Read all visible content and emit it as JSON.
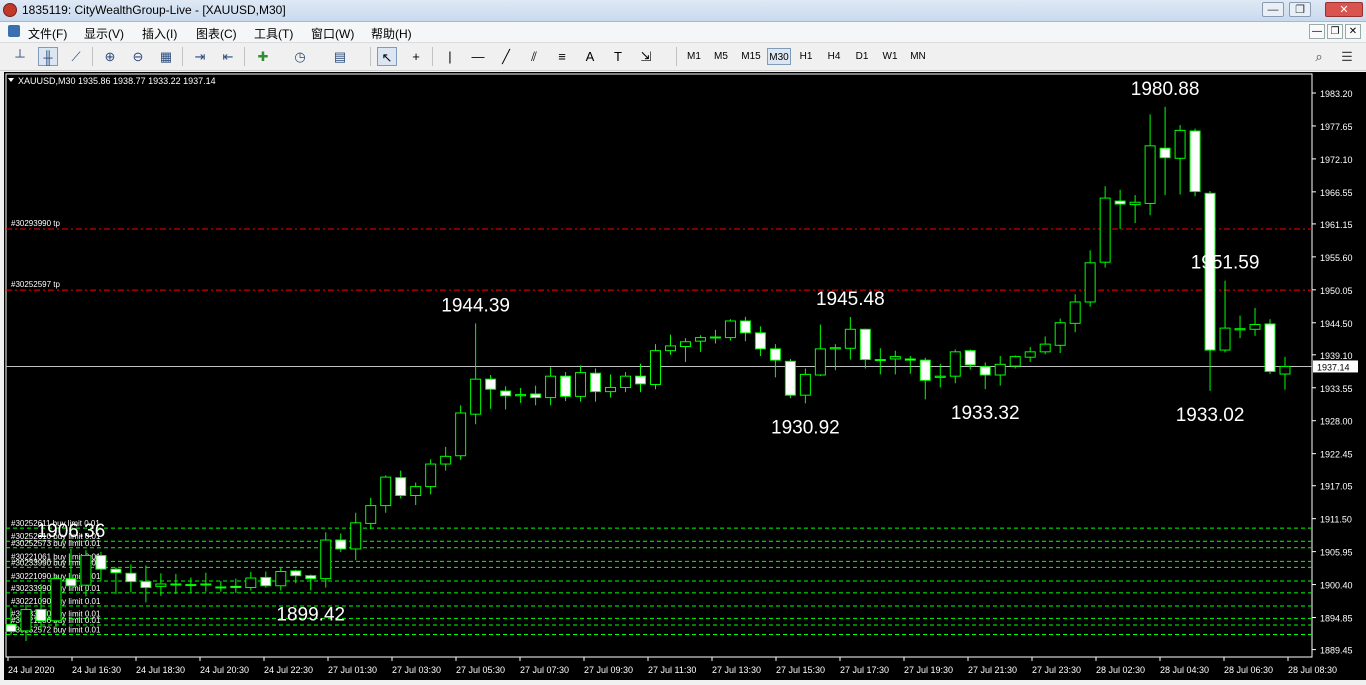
{
  "window": {
    "title": "1835119: CityWealthGroup-Live - [XAUUSD,M30]",
    "controls": {
      "minimize": "—",
      "restore": "❐",
      "close": "✕"
    }
  },
  "menu": {
    "items": [
      "文件(F)",
      "显示(V)",
      "插入(I)",
      "图表(C)",
      "工具(T)",
      "窗口(W)",
      "帮助(H)"
    ]
  },
  "toolbar": {
    "timeframes": [
      "M1",
      "M5",
      "M15",
      "M30",
      "H1",
      "H4",
      "D1",
      "W1",
      "MN"
    ],
    "active_timeframe": "M30",
    "icons": [
      "bar-chart-icon",
      "candlestick-icon",
      "line-chart-icon",
      "zoom-in-icon",
      "zoom-out-icon",
      "tile-windows-icon",
      "autoscroll-icon",
      "chart-shift-icon",
      "indicators-icon",
      "periods-icon",
      "templates-icon",
      "cursor-icon",
      "crosshair-icon",
      "vertical-line-icon",
      "horizontal-line-icon",
      "trendline-icon",
      "equidistant-channel-icon",
      "fibonacci-icon",
      "text-icon",
      "text-label-icon",
      "arrows-icon"
    ]
  },
  "chart_info": {
    "label": "XAUUSD,M30  1935.86 1938.77 1933.22 1937.14"
  },
  "colors": {
    "background": "#000000",
    "bull": "#00ff00",
    "bear_body": "#ffffff",
    "grid": "#ff0000",
    "order": "#00ff00",
    "bid": "#c0c0c0"
  },
  "current_price": "1937.14",
  "chart_data": {
    "type": "candlestick",
    "symbol": "XAUUSD",
    "timeframe": "M30",
    "ylim": [
      1888.2,
      1986.4
    ],
    "price_ticks": [
      "1983.20",
      "1977.65",
      "1972.10",
      "1966.55",
      "1961.15",
      "1955.60",
      "1950.05",
      "1944.50",
      "1939.10",
      "1933.55",
      "1928.00",
      "1922.45",
      "1917.05",
      "1911.50",
      "1905.95",
      "1900.40",
      "1894.85",
      "1889.45"
    ],
    "time_ticks": [
      "24 Jul 2020",
      "24 Jul 16:30",
      "24 Jul 18:30",
      "24 Jul 20:30",
      "24 Jul 22:30",
      "27 Jul 01:30",
      "27 Jul 03:30",
      "27 Jul 05:30",
      "27 Jul 07:30",
      "27 Jul 09:30",
      "27 Jul 11:30",
      "27 Jul 13:30",
      "27 Jul 15:30",
      "27 Jul 17:30",
      "27 Jul 19:30",
      "27 Jul 21:30",
      "27 Jul 23:30",
      "28 Jul 02:30",
      "28 Jul 04:30",
      "28 Jul 06:30",
      "28 Jul 08:30"
    ],
    "candles": [
      {
        "o": 1893.7,
        "h": 1896.5,
        "l": 1891.9,
        "c": 1892.5
      },
      {
        "o": 1892.6,
        "h": 1897.0,
        "l": 1890.9,
        "c": 1896.2
      },
      {
        "o": 1896.2,
        "h": 1900.5,
        "l": 1892.5,
        "c": 1894.3
      },
      {
        "o": 1894.3,
        "h": 1901.8,
        "l": 1893.0,
        "c": 1901.4
      },
      {
        "o": 1901.4,
        "h": 1906.4,
        "l": 1899.8,
        "c": 1900.2
      },
      {
        "o": 1900.3,
        "h": 1906.2,
        "l": 1898.4,
        "c": 1905.3
      },
      {
        "o": 1905.3,
        "h": 1905.9,
        "l": 1901.1,
        "c": 1903.0
      },
      {
        "o": 1903.0,
        "h": 1903.3,
        "l": 1898.8,
        "c": 1902.4
      },
      {
        "o": 1902.3,
        "h": 1903.8,
        "l": 1899.1,
        "c": 1900.9
      },
      {
        "o": 1900.9,
        "h": 1903.6,
        "l": 1897.4,
        "c": 1899.9
      },
      {
        "o": 1900.1,
        "h": 1902.3,
        "l": 1898.5,
        "c": 1900.5
      },
      {
        "o": 1900.4,
        "h": 1902.2,
        "l": 1898.8,
        "c": 1900.5
      },
      {
        "o": 1900.4,
        "h": 1901.6,
        "l": 1899.0,
        "c": 1900.3
      },
      {
        "o": 1900.4,
        "h": 1902.4,
        "l": 1899.2,
        "c": 1900.5
      },
      {
        "o": 1900.0,
        "h": 1901.0,
        "l": 1899.2,
        "c": 1900.0
      },
      {
        "o": 1900.1,
        "h": 1901.4,
        "l": 1899.0,
        "c": 1899.9
      },
      {
        "o": 1899.9,
        "h": 1902.5,
        "l": 1899.4,
        "c": 1901.5
      },
      {
        "o": 1901.6,
        "h": 1902.6,
        "l": 1899.9,
        "c": 1900.2
      },
      {
        "o": 1900.2,
        "h": 1903.2,
        "l": 1899.4,
        "c": 1902.6
      },
      {
        "o": 1902.7,
        "h": 1902.9,
        "l": 1900.6,
        "c": 1901.9
      },
      {
        "o": 1901.9,
        "h": 1902.1,
        "l": 1899.42,
        "c": 1901.4
      },
      {
        "o": 1901.4,
        "h": 1909.2,
        "l": 1899.9,
        "c": 1907.9
      },
      {
        "o": 1907.9,
        "h": 1909.0,
        "l": 1905.9,
        "c": 1906.4
      },
      {
        "o": 1906.4,
        "h": 1912.5,
        "l": 1904.5,
        "c": 1910.8
      },
      {
        "o": 1910.7,
        "h": 1915.0,
        "l": 1909.7,
        "c": 1913.7
      },
      {
        "o": 1913.7,
        "h": 1918.8,
        "l": 1912.5,
        "c": 1918.5
      },
      {
        "o": 1918.4,
        "h": 1919.6,
        "l": 1914.9,
        "c": 1915.4
      },
      {
        "o": 1915.4,
        "h": 1917.6,
        "l": 1913.8,
        "c": 1916.9
      },
      {
        "o": 1916.9,
        "h": 1921.5,
        "l": 1915.6,
        "c": 1920.7
      },
      {
        "o": 1920.7,
        "h": 1923.6,
        "l": 1919.6,
        "c": 1922.0
      },
      {
        "o": 1922.1,
        "h": 1930.6,
        "l": 1921.4,
        "c": 1929.3
      },
      {
        "o": 1929.1,
        "h": 1944.39,
        "l": 1927.4,
        "c": 1935.0
      },
      {
        "o": 1935.0,
        "h": 1935.7,
        "l": 1930.0,
        "c": 1933.3
      },
      {
        "o": 1933.0,
        "h": 1933.8,
        "l": 1929.9,
        "c": 1932.2
      },
      {
        "o": 1932.2,
        "h": 1933.5,
        "l": 1931.0,
        "c": 1932.4
      },
      {
        "o": 1932.5,
        "h": 1933.9,
        "l": 1930.6,
        "c": 1931.9
      },
      {
        "o": 1931.9,
        "h": 1937.0,
        "l": 1930.6,
        "c": 1935.5
      },
      {
        "o": 1935.5,
        "h": 1936.2,
        "l": 1931.3,
        "c": 1932.1
      },
      {
        "o": 1932.1,
        "h": 1937.3,
        "l": 1931.2,
        "c": 1936.1
      },
      {
        "o": 1936.0,
        "h": 1936.8,
        "l": 1931.2,
        "c": 1932.9
      },
      {
        "o": 1932.9,
        "h": 1935.8,
        "l": 1931.9,
        "c": 1933.6
      },
      {
        "o": 1933.6,
        "h": 1936.2,
        "l": 1932.8,
        "c": 1935.5
      },
      {
        "o": 1935.5,
        "h": 1937.6,
        "l": 1932.8,
        "c": 1934.2
      },
      {
        "o": 1934.1,
        "h": 1940.9,
        "l": 1933.3,
        "c": 1939.8
      },
      {
        "o": 1939.8,
        "h": 1942.5,
        "l": 1939.1,
        "c": 1940.6
      },
      {
        "o": 1940.5,
        "h": 1941.9,
        "l": 1937.9,
        "c": 1941.3
      },
      {
        "o": 1941.4,
        "h": 1942.4,
        "l": 1939.6,
        "c": 1942.0
      },
      {
        "o": 1942.0,
        "h": 1943.3,
        "l": 1941.0,
        "c": 1942.1
      },
      {
        "o": 1942.0,
        "h": 1945.1,
        "l": 1941.5,
        "c": 1944.8
      },
      {
        "o": 1944.8,
        "h": 1945.5,
        "l": 1941.4,
        "c": 1942.8
      },
      {
        "o": 1942.8,
        "h": 1943.9,
        "l": 1938.9,
        "c": 1940.1
      },
      {
        "o": 1940.1,
        "h": 1940.9,
        "l": 1935.3,
        "c": 1938.2
      },
      {
        "o": 1938.0,
        "h": 1938.4,
        "l": 1931.8,
        "c": 1932.3
      },
      {
        "o": 1932.3,
        "h": 1936.8,
        "l": 1930.92,
        "c": 1935.8
      },
      {
        "o": 1935.7,
        "h": 1944.2,
        "l": 1935.5,
        "c": 1940.1
      },
      {
        "o": 1940.1,
        "h": 1940.9,
        "l": 1936.5,
        "c": 1940.3
      },
      {
        "o": 1940.2,
        "h": 1945.48,
        "l": 1938.3,
        "c": 1943.4
      },
      {
        "o": 1943.4,
        "h": 1943.5,
        "l": 1936.8,
        "c": 1938.3
      },
      {
        "o": 1938.3,
        "h": 1940.2,
        "l": 1935.8,
        "c": 1938.2
      },
      {
        "o": 1938.4,
        "h": 1939.8,
        "l": 1935.8,
        "c": 1938.8
      },
      {
        "o": 1938.4,
        "h": 1938.9,
        "l": 1935.9,
        "c": 1938.2
      },
      {
        "o": 1938.2,
        "h": 1938.6,
        "l": 1931.6,
        "c": 1934.8
      },
      {
        "o": 1935.3,
        "h": 1937.6,
        "l": 1933.6,
        "c": 1935.5
      },
      {
        "o": 1935.5,
        "h": 1940.0,
        "l": 1934.3,
        "c": 1939.6
      },
      {
        "o": 1939.8,
        "h": 1940.0,
        "l": 1936.6,
        "c": 1937.4
      },
      {
        "o": 1937.1,
        "h": 1937.8,
        "l": 1933.32,
        "c": 1935.7
      },
      {
        "o": 1935.7,
        "h": 1938.9,
        "l": 1933.9,
        "c": 1937.5
      },
      {
        "o": 1937.2,
        "h": 1939.0,
        "l": 1936.8,
        "c": 1938.8
      },
      {
        "o": 1938.7,
        "h": 1940.4,
        "l": 1937.9,
        "c": 1939.6
      },
      {
        "o": 1939.6,
        "h": 1942.2,
        "l": 1939.2,
        "c": 1940.9
      },
      {
        "o": 1940.7,
        "h": 1945.2,
        "l": 1939.4,
        "c": 1944.5
      },
      {
        "o": 1944.4,
        "h": 1949.3,
        "l": 1942.9,
        "c": 1948.0
      },
      {
        "o": 1948.0,
        "h": 1956.7,
        "l": 1947.2,
        "c": 1954.6
      },
      {
        "o": 1954.7,
        "h": 1967.5,
        "l": 1953.8,
        "c": 1965.5
      },
      {
        "o": 1965.0,
        "h": 1966.9,
        "l": 1960.3,
        "c": 1964.5
      },
      {
        "o": 1964.4,
        "h": 1966.0,
        "l": 1961.3,
        "c": 1964.8
      },
      {
        "o": 1964.6,
        "h": 1979.6,
        "l": 1962.6,
        "c": 1974.3
      },
      {
        "o": 1973.9,
        "h": 1980.88,
        "l": 1966.0,
        "c": 1972.3
      },
      {
        "o": 1972.2,
        "h": 1977.8,
        "l": 1966.1,
        "c": 1976.9
      },
      {
        "o": 1976.8,
        "h": 1977.2,
        "l": 1965.8,
        "c": 1966.6
      },
      {
        "o": 1966.3,
        "h": 1966.7,
        "l": 1933.02,
        "c": 1939.9
      },
      {
        "o": 1939.9,
        "h": 1951.59,
        "l": 1939.5,
        "c": 1943.6
      },
      {
        "o": 1943.3,
        "h": 1945.7,
        "l": 1941.9,
        "c": 1943.5
      },
      {
        "o": 1943.4,
        "h": 1947.0,
        "l": 1942.3,
        "c": 1944.2
      },
      {
        "o": 1944.3,
        "h": 1945.1,
        "l": 1935.86,
        "c": 1936.3
      },
      {
        "o": 1935.86,
        "h": 1938.77,
        "l": 1933.22,
        "c": 1937.14
      }
    ],
    "annotations": [
      {
        "text": "1906.36",
        "price": 1906.36
      },
      {
        "text": "1899.42",
        "price": 1899.42
      },
      {
        "text": "1944.39",
        "price": 1944.39
      },
      {
        "text": "1930.92",
        "price": 1930.92
      },
      {
        "text": "1945.48",
        "price": 1945.48
      },
      {
        "text": "1933.32",
        "price": 1933.32
      },
      {
        "text": "1980.88",
        "price": 1980.88
      },
      {
        "text": "1951.59",
        "price": 1951.59
      },
      {
        "text": "1933.02",
        "price": 1933.02
      }
    ],
    "tp_lines": [
      {
        "price": 1960.3,
        "label": "#30293990 tp"
      },
      {
        "price": 1950.0,
        "label": "#30252597 tp"
      }
    ],
    "order_lines": [
      {
        "price": 1909.9,
        "label": "#30252611 buy limit 0.01"
      },
      {
        "price": 1907.7,
        "label": "#30252610 buy limit 0.01"
      },
      {
        "price": 1906.6,
        "label": "#30252573 buy limit 0.01"
      },
      {
        "price": 1904.3,
        "label": "#30221061 buy limit 0.01"
      },
      {
        "price": 1903.3,
        "label": "#30233990 buy limit 0.01"
      },
      {
        "price": 1901.0,
        "label": "#30221090 buy limit 0.01"
      },
      {
        "price": 1899.0,
        "label": "#30233990 buy limit 0.01"
      },
      {
        "price": 1896.8,
        "label": "#30221090 buy limit 0.01"
      },
      {
        "price": 1894.7,
        "label": "#30233990 buy limit 0.01"
      },
      {
        "price": 1893.6,
        "label": "#30221286 buy limit 0.01"
      },
      {
        "price": 1892.0,
        "label": "#30252572 buy limit 0.01"
      }
    ]
  }
}
